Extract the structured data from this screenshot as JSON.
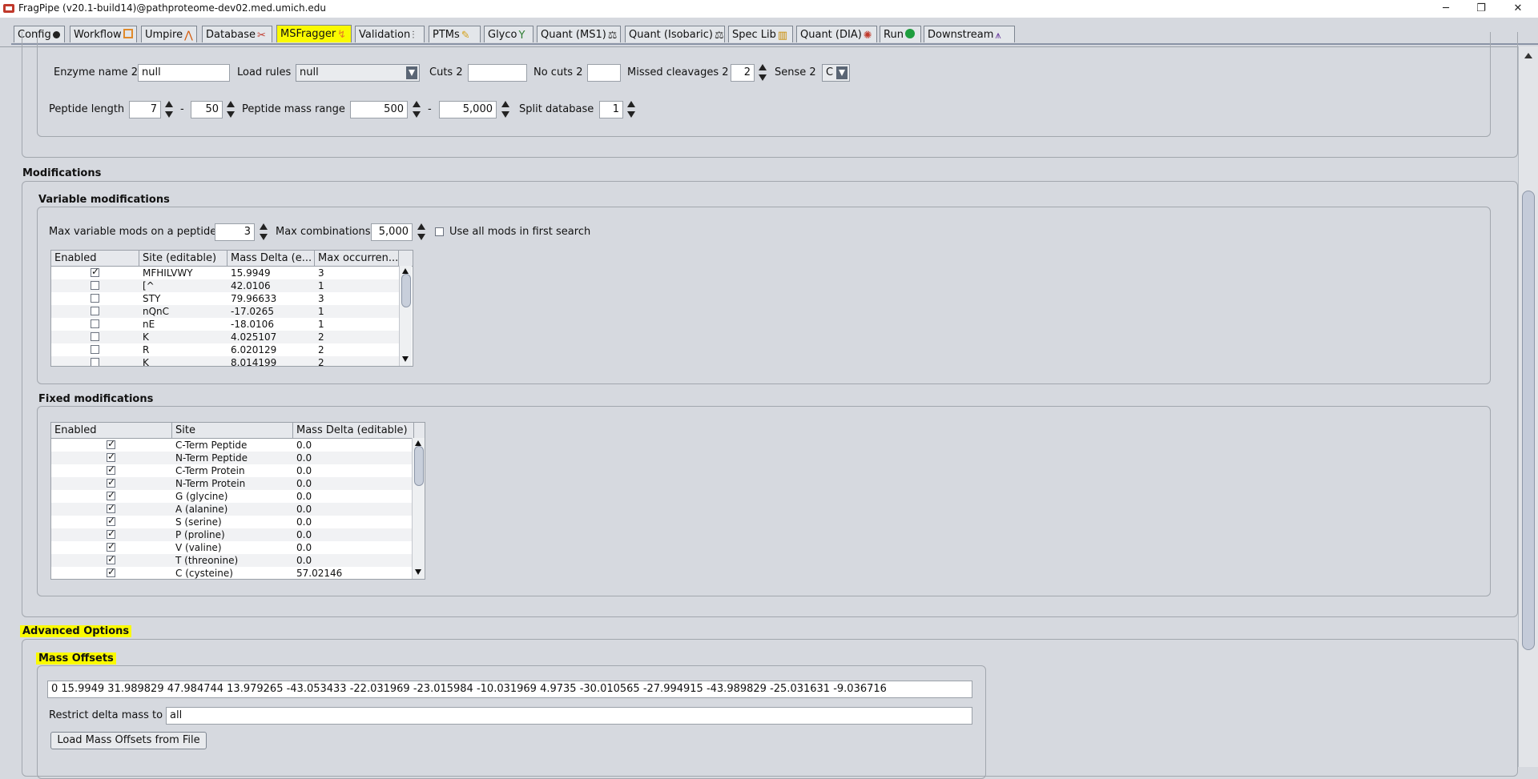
{
  "window": {
    "title": "FragPipe (v20.1-build14)@pathproteome-dev02.med.umich.edu",
    "minimize": "─",
    "restore": "❐",
    "close": "✕"
  },
  "tabs": [
    {
      "label": "Config",
      "icon": "gear-icon"
    },
    {
      "label": "Workflow",
      "icon": "workflow-icon"
    },
    {
      "label": "Umpire",
      "icon": "peak-icon"
    },
    {
      "label": "Database",
      "icon": "database-icon"
    },
    {
      "label": "MSFragger",
      "icon": "lightning-icon",
      "active": true
    },
    {
      "label": "Validation",
      "icon": "validation-icon"
    },
    {
      "label": "PTMs",
      "icon": "pencil-icon"
    },
    {
      "label": "Glyco",
      "icon": "glyco-icon"
    },
    {
      "label": "Quant (MS1)",
      "icon": "scale-icon"
    },
    {
      "label": "Quant (Isobaric)",
      "icon": "scale-icon"
    },
    {
      "label": "Spec Lib",
      "icon": "library-icon"
    },
    {
      "label": "Quant (DIA)",
      "icon": "gear-icon"
    },
    {
      "label": "Run",
      "icon": "play-icon"
    },
    {
      "label": "Downstream",
      "icon": "network-icon"
    }
  ],
  "digest": {
    "enzyme_name2_label": "Enzyme name 2",
    "enzyme_name2": "null",
    "load_rules_label": "Load rules",
    "load_rules": "null",
    "cuts2_label": "Cuts 2",
    "cuts2": "",
    "no_cuts2_label": "No cuts 2",
    "no_cuts2": "",
    "missed_cleavages2_label": "Missed cleavages 2",
    "missed_cleavages2": "2",
    "sense2_label": "Sense 2",
    "sense2": "C",
    "peptide_length_label": "Peptide length",
    "peptide_length_min": "7",
    "peptide_length_max": "50",
    "dash": "-",
    "mass_range_label": "Peptide mass range",
    "mass_range_min": "500",
    "mass_range_max": "5,000",
    "split_db_label": "Split database",
    "split_db": "1"
  },
  "modifications": {
    "title": "Modifications",
    "variable": {
      "title": "Variable modifications",
      "max_mods_label": "Max variable mods on a peptide",
      "max_mods": "3",
      "max_comb_label": "Max combinations",
      "max_comb": "5,000",
      "use_all_label": "Use all mods in first search",
      "use_all_checked": false,
      "columns": [
        "Enabled",
        "Site (editable)",
        "Mass Delta (e...",
        "Max occurren..."
      ],
      "rows": [
        {
          "enabled": true,
          "site": "MFHILVWY",
          "mass": "15.9949",
          "max": "3"
        },
        {
          "enabled": false,
          "site": "[^",
          "mass": "42.0106",
          "max": "1"
        },
        {
          "enabled": false,
          "site": "STY",
          "mass": "79.96633",
          "max": "3"
        },
        {
          "enabled": false,
          "site": "nQnC",
          "mass": "-17.0265",
          "max": "1"
        },
        {
          "enabled": false,
          "site": "nE",
          "mass": "-18.0106",
          "max": "1"
        },
        {
          "enabled": false,
          "site": "K",
          "mass": "4.025107",
          "max": "2"
        },
        {
          "enabled": false,
          "site": "R",
          "mass": "6.020129",
          "max": "2"
        },
        {
          "enabled": false,
          "site": "K",
          "mass": "8.014199",
          "max": "2"
        }
      ]
    },
    "fixed": {
      "title": "Fixed modifications",
      "columns": [
        "Enabled",
        "Site",
        "Mass Delta (editable)"
      ],
      "rows": [
        {
          "enabled": true,
          "site": "C-Term Peptide",
          "mass": "0.0"
        },
        {
          "enabled": true,
          "site": "N-Term Peptide",
          "mass": "0.0"
        },
        {
          "enabled": true,
          "site": "C-Term Protein",
          "mass": "0.0"
        },
        {
          "enabled": true,
          "site": "N-Term Protein",
          "mass": "0.0"
        },
        {
          "enabled": true,
          "site": "G (glycine)",
          "mass": "0.0"
        },
        {
          "enabled": true,
          "site": "A (alanine)",
          "mass": "0.0"
        },
        {
          "enabled": true,
          "site": "S (serine)",
          "mass": "0.0"
        },
        {
          "enabled": true,
          "site": "P (proline)",
          "mass": "0.0"
        },
        {
          "enabled": true,
          "site": "V (valine)",
          "mass": "0.0"
        },
        {
          "enabled": true,
          "site": "T (threonine)",
          "mass": "0.0"
        },
        {
          "enabled": true,
          "site": "C (cysteine)",
          "mass": "57.02146"
        }
      ]
    }
  },
  "advanced": {
    "title": "Advanced Options",
    "mass_offsets_title": "Mass Offsets",
    "mass_offsets": "0 15.9949 31.989829 47.984744 13.979265 -43.053433 -22.031969 -23.015984 -10.031969 4.9735 -30.010565 -27.994915 -43.989829 -25.031631 -9.036716",
    "restrict_label": "Restrict delta mass to",
    "restrict_value": "all",
    "load_button": "Load Mass Offsets from File"
  }
}
